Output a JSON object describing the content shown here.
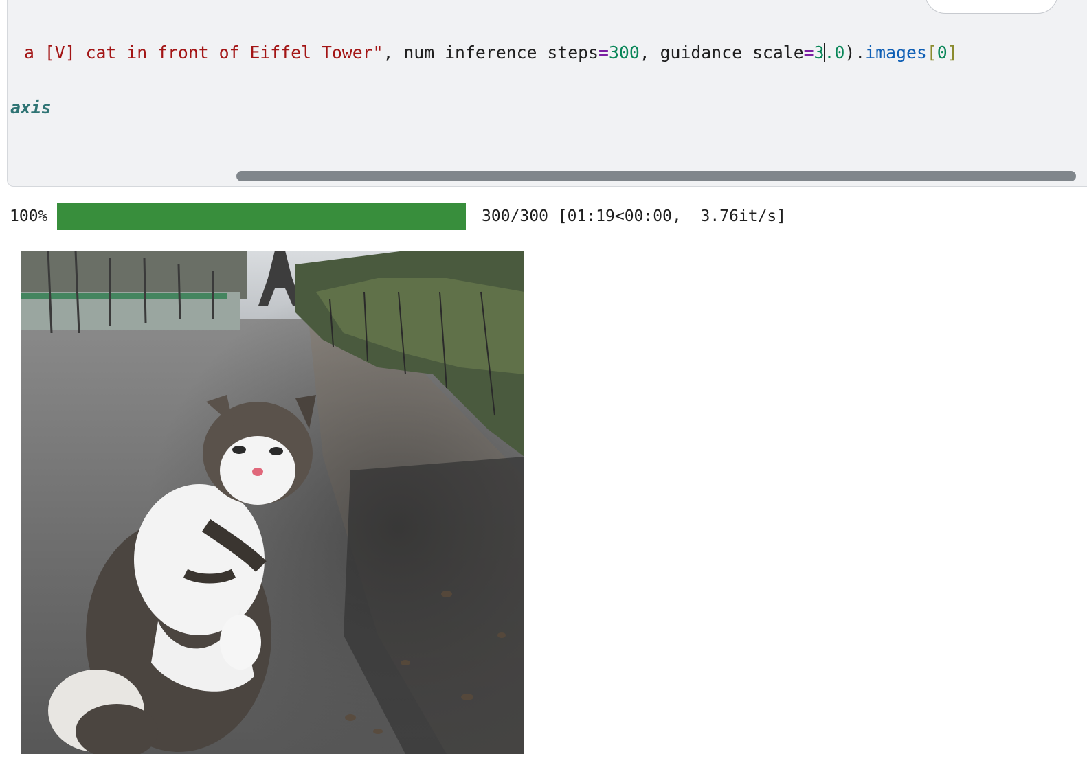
{
  "code_cell": {
    "line1": {
      "string_part": "a [V] cat in front of Eiffel Tower\"",
      "sep1": ", ",
      "param1_name": "num_inference_steps",
      "param1_eq": "=",
      "param1_value": "300",
      "sep2": ", ",
      "param2_name": "guidance_scale",
      "param2_eq": "=",
      "param2_value_a": "3",
      "param2_value_b": ".0",
      "close": ").",
      "attr": "images",
      "bracket_open": "[",
      "index": "0",
      "bracket_close": "]"
    },
    "line2": {
      "keyword": "axis"
    },
    "toolbar_icons": [
      "arrow-up-icon",
      "arrow-down-icon",
      "delete-icon"
    ]
  },
  "progress": {
    "percent_label": "100%",
    "fraction": 1.0,
    "stats": "300/300 [01:19<00:00,  3.76it/s]",
    "fill_color": "#388e3c"
  },
  "output": {
    "image_name": "generated-cat-eiffel-tower"
  }
}
